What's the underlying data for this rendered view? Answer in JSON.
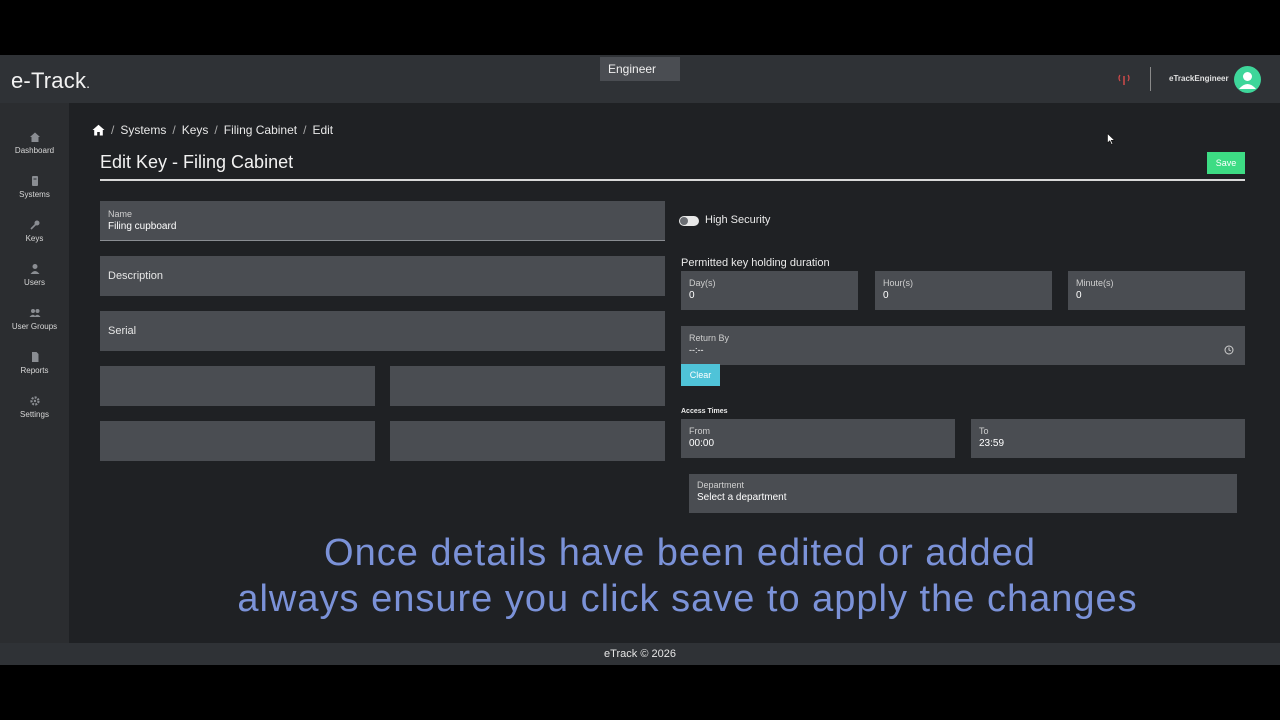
{
  "app": {
    "logo": "e-Track",
    "logo_dot": ".",
    "role": "Engineer",
    "username": "eTrackEngineer",
    "accent_color": "#3ddc84",
    "footer": "eTrack © 2026"
  },
  "sidebar": {
    "items": [
      {
        "label": "Dashboard",
        "icon": "home-icon"
      },
      {
        "label": "Systems",
        "icon": "server-icon"
      },
      {
        "label": "Keys",
        "icon": "key-icon"
      },
      {
        "label": "Users",
        "icon": "user-icon"
      },
      {
        "label": "User Groups",
        "icon": "users-icon"
      },
      {
        "label": "Reports",
        "icon": "document-icon"
      },
      {
        "label": "Settings",
        "icon": "gear-icon"
      }
    ]
  },
  "breadcrumb": {
    "items": [
      "Systems",
      "Keys",
      "Filing Cabinet",
      "Edit"
    ]
  },
  "page": {
    "title": "Edit Key - Filing Cabinet",
    "save_label": "Save"
  },
  "form": {
    "name_label": "Name",
    "name_value": "Filing cupboard",
    "description_placeholder": "Description",
    "serial_placeholder": "Serial",
    "high_security_label": "High Security",
    "duration_label": "Permitted key holding duration",
    "days_label": "Day(s)",
    "days_value": "0",
    "hours_label": "Hour(s)",
    "hours_value": "0",
    "minutes_label": "Minute(s)",
    "minutes_value": "0",
    "return_by_label": "Return By",
    "return_by_value": "--:--",
    "clear_label": "Clear",
    "access_times_label": "Access Times",
    "from_label": "From",
    "from_value": "00:00",
    "to_label": "To",
    "to_value": "23:59",
    "department_label": "Department",
    "department_value": "Select a department"
  },
  "caption": {
    "line1": "Once details have been edited or added",
    "line2": "always ensure you click save to apply the changes"
  }
}
